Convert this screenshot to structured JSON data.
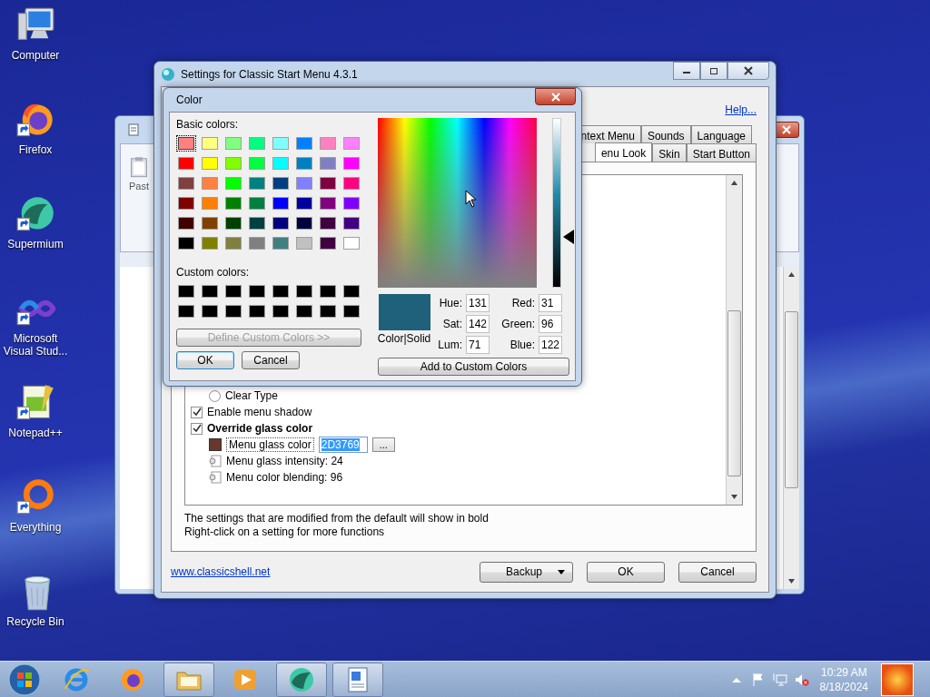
{
  "desktop_icons": [
    {
      "kind": "computer",
      "label": "Computer",
      "shortcut": false
    },
    {
      "kind": "firefox",
      "label": "Firefox",
      "shortcut": true
    },
    {
      "kind": "supermium",
      "label": "Supermium",
      "shortcut": true
    },
    {
      "kind": "vstudio",
      "label": "Microsoft Visual Stud...",
      "shortcut": true
    },
    {
      "kind": "notepad",
      "label": "Notepad++",
      "shortcut": true
    },
    {
      "kind": "everything",
      "label": "Everything",
      "shortcut": true
    },
    {
      "kind": "recycle",
      "label": "Recycle Bin",
      "shortcut": false
    }
  ],
  "background_window": {
    "ribbon_label": "Past"
  },
  "settings_window": {
    "title": "Settings for Classic Start Menu 4.3.1",
    "help_link": "Help...",
    "tab_rows": [
      {
        "tabs": [
          {
            "label": "ntext Menu",
            "selected": false
          },
          {
            "label": "Sounds",
            "selected": false
          },
          {
            "label": "Language",
            "selected": false
          }
        ]
      },
      {
        "tabs": [
          {
            "label": "enu Look",
            "selected": true
          },
          {
            "label": "Skin",
            "selected": false
          },
          {
            "label": "Start Button",
            "selected": false
          }
        ]
      }
    ],
    "settings": [
      {
        "kind": "radio",
        "label": "Clear Type",
        "checked": false,
        "bold": false
      },
      {
        "kind": "checkbox",
        "label": "Enable menu shadow",
        "checked": true,
        "bold": false
      },
      {
        "kind": "checkbox",
        "label": "Override glass color",
        "checked": true,
        "bold": true
      },
      {
        "kind": "color",
        "label": "Menu glass color",
        "value": "2D3769",
        "value_selected": true,
        "browse_label": "...",
        "color": "#69372d",
        "bold": false
      },
      {
        "kind": "number",
        "label": "Menu glass intensity: 24",
        "bold": false
      },
      {
        "kind": "number",
        "label": "Menu color blending: 96",
        "bold": false
      }
    ],
    "notes": [
      "The settings that are modified from the default will show in bold",
      "Right-click on a setting for more functions"
    ],
    "link": "www.classicshell.net",
    "buttons": [
      {
        "label": "Backup",
        "dropdown": true
      },
      {
        "label": "OK",
        "dropdown": false
      },
      {
        "label": "Cancel",
        "dropdown": false
      }
    ]
  },
  "color_dialog": {
    "title": "Color",
    "basic_colors_label": "Basic colors:",
    "basic_colors": [
      {
        "color": "#ff8080",
        "selected": true
      },
      {
        "color": "#ffff80",
        "selected": false
      },
      {
        "color": "#80ff80",
        "selected": false
      },
      {
        "color": "#00ff80",
        "selected": false
      },
      {
        "color": "#80ffff",
        "selected": false
      },
      {
        "color": "#0080ff",
        "selected": false
      },
      {
        "color": "#ff80c0",
        "selected": false
      },
      {
        "color": "#ff80ff",
        "selected": false
      },
      {
        "color": "#ff0000",
        "selected": false
      },
      {
        "color": "#ffff00",
        "selected": false
      },
      {
        "color": "#80ff00",
        "selected": false
      },
      {
        "color": "#00ff40",
        "selected": false
      },
      {
        "color": "#00ffff",
        "selected": false
      },
      {
        "color": "#0080c0",
        "selected": false
      },
      {
        "color": "#8080c0",
        "selected": false
      },
      {
        "color": "#ff00ff",
        "selected": false
      },
      {
        "color": "#804040",
        "selected": false
      },
      {
        "color": "#ff8040",
        "selected": false
      },
      {
        "color": "#00ff00",
        "selected": false
      },
      {
        "color": "#008080",
        "selected": false
      },
      {
        "color": "#004080",
        "selected": false
      },
      {
        "color": "#8080ff",
        "selected": false
      },
      {
        "color": "#800040",
        "selected": false
      },
      {
        "color": "#ff0080",
        "selected": false
      },
      {
        "color": "#800000",
        "selected": false
      },
      {
        "color": "#ff8000",
        "selected": false
      },
      {
        "color": "#008000",
        "selected": false
      },
      {
        "color": "#008040",
        "selected": false
      },
      {
        "color": "#0000ff",
        "selected": false
      },
      {
        "color": "#0000a0",
        "selected": false
      },
      {
        "color": "#800080",
        "selected": false
      },
      {
        "color": "#8000ff",
        "selected": false
      },
      {
        "color": "#400000",
        "selected": false
      },
      {
        "color": "#804000",
        "selected": false
      },
      {
        "color": "#004000",
        "selected": false
      },
      {
        "color": "#004040",
        "selected": false
      },
      {
        "color": "#000080",
        "selected": false
      },
      {
        "color": "#000040",
        "selected": false
      },
      {
        "color": "#400040",
        "selected": false
      },
      {
        "color": "#400080",
        "selected": false
      },
      {
        "color": "#000000",
        "selected": false
      },
      {
        "color": "#808000",
        "selected": false
      },
      {
        "color": "#808040",
        "selected": false
      },
      {
        "color": "#808080",
        "selected": false
      },
      {
        "color": "#408080",
        "selected": false
      },
      {
        "color": "#c0c0c0",
        "selected": false
      },
      {
        "color": "#400040",
        "selected": false
      },
      {
        "color": "#ffffff",
        "selected": false
      }
    ],
    "custom_colors_label": "Custom colors:",
    "custom_colors": [
      {
        "color": "#000000"
      },
      {
        "color": "#000000"
      },
      {
        "color": "#000000"
      },
      {
        "color": "#000000"
      },
      {
        "color": "#000000"
      },
      {
        "color": "#000000"
      },
      {
        "color": "#000000"
      },
      {
        "color": "#000000"
      },
      {
        "color": "#000000"
      },
      {
        "color": "#000000"
      },
      {
        "color": "#000000"
      },
      {
        "color": "#000000"
      },
      {
        "color": "#000000"
      },
      {
        "color": "#000000"
      },
      {
        "color": "#000000"
      },
      {
        "color": "#000000"
      }
    ],
    "define_button": {
      "label": "Define Custom Colors >>",
      "disabled": true
    },
    "ok_button": "OK",
    "cancel_button": "Cancel",
    "luminance": {
      "level": 0.3
    },
    "preview": {
      "color": "#1f607a",
      "label": "Color|Solid"
    },
    "fields": [
      {
        "label": "Hue:",
        "value": "131"
      },
      {
        "label": "Red:",
        "value": "31"
      },
      {
        "label": "Sat:",
        "value": "142"
      },
      {
        "label": "Green:",
        "value": "96"
      },
      {
        "label": "Lum:",
        "value": "71"
      },
      {
        "label": "Blue:",
        "value": "122"
      }
    ],
    "add_button": "Add to Custom Colors"
  },
  "taskbar": {
    "items": [
      {
        "kind": "ie",
        "open": false
      },
      {
        "kind": "firefox",
        "open": false
      },
      {
        "kind": "folder",
        "open": true
      },
      {
        "kind": "media",
        "open": false
      },
      {
        "kind": "supermium",
        "open": true
      },
      {
        "kind": "wordpad",
        "open": true
      }
    ],
    "clock": {
      "time": "10:29 AM",
      "date": "8/18/2024"
    }
  }
}
